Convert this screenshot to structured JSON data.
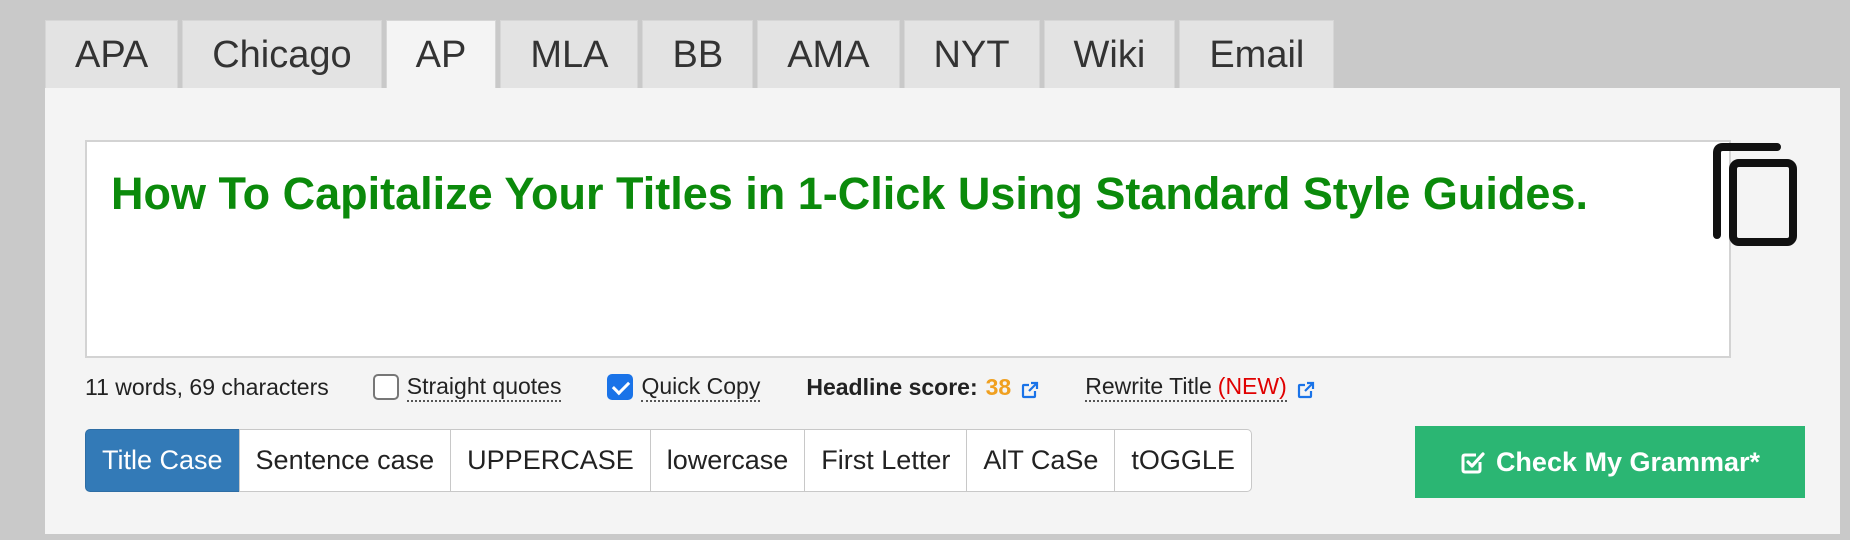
{
  "tabs": [
    {
      "label": "APA",
      "active": false
    },
    {
      "label": "Chicago",
      "active": false
    },
    {
      "label": "AP",
      "active": true
    },
    {
      "label": "MLA",
      "active": false
    },
    {
      "label": "BB",
      "active": false
    },
    {
      "label": "AMA",
      "active": false
    },
    {
      "label": "NYT",
      "active": false
    },
    {
      "label": "Wiki",
      "active": false
    },
    {
      "label": "Email",
      "active": false
    }
  ],
  "editor": {
    "text": "How To Capitalize Your Titles in 1-Click Using Standard Style Guides.",
    "text_color": "#0b8a0b"
  },
  "copy_icon": "copy-icon",
  "status": {
    "counts": "11 words, 69 characters",
    "straight_quotes_label": "Straight quotes",
    "straight_quotes_checked": false,
    "quick_copy_label": "Quick Copy",
    "quick_copy_checked": true,
    "headline_score_label": "Headline score:",
    "headline_score_value": "38",
    "rewrite_label": "Rewrite Title",
    "rewrite_new": "(NEW)"
  },
  "case_buttons": [
    {
      "label": "Title Case",
      "active": true
    },
    {
      "label": "Sentence case",
      "active": false
    },
    {
      "label": "UPPERCASE",
      "active": false
    },
    {
      "label": "lowercase",
      "active": false
    },
    {
      "label": "First Letter",
      "active": false
    },
    {
      "label": "AlT CaSe",
      "active": false
    },
    {
      "label": "tOGGLE",
      "active": false
    }
  ],
  "grammar_button": {
    "label": "Check My Grammar*",
    "icon": "check-square-icon",
    "color": "#2bb673"
  },
  "colors": {
    "accent": "#337ab7",
    "score": "#f0a020",
    "new": "#e00000",
    "link_icon": "#1a73e8"
  }
}
